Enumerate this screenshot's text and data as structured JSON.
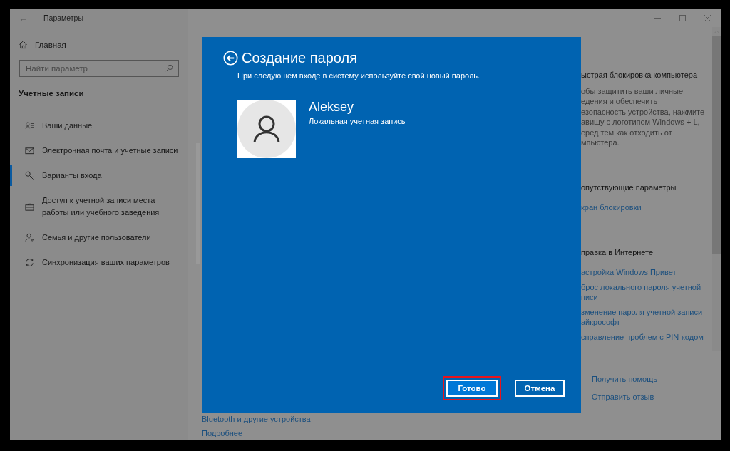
{
  "window": {
    "title": "Параметры",
    "back": "←"
  },
  "sidebar": {
    "home": "Главная",
    "search": {
      "placeholder": "Найти параметр"
    },
    "section": "Учетные записи",
    "items": [
      {
        "label": "Ваши данные",
        "kind": "person-list",
        "selected": false
      },
      {
        "label": "Электронная почта и учетные записи",
        "kind": "mail",
        "selected": false
      },
      {
        "label": "Варианты входа",
        "kind": "key",
        "selected": true
      },
      {
        "label": "Доступ к учетной записи места работы или учебного заведения",
        "kind": "briefcase",
        "selected": false
      },
      {
        "label": "Семья и другие пользователи",
        "kind": "person-add",
        "selected": false
      },
      {
        "label": "Синхронизация ваших параметров",
        "kind": "sync",
        "selected": false
      }
    ]
  },
  "content": {
    "bottom_links": [
      "Bluetooth и другие устройства",
      "Подробнее"
    ],
    "right_panel": [
      {
        "kind": "heading",
        "lines": [
          "ыстрая блокировка компьютера"
        ]
      },
      {
        "kind": "text",
        "lines": [
          "обы защитить ваши личные",
          "едения и обеспечить",
          "езопасность устройства, нажмите",
          "авишу с логотипом Windows + L,",
          "еред тем как отходить от",
          "мпьютера."
        ]
      },
      {
        "kind": "heading",
        "lines": [
          "опутствующие параметры"
        ]
      },
      {
        "kind": "link",
        "lines": [
          "кран блокировки"
        ]
      },
      {
        "kind": "heading",
        "lines": [
          "правка в Интернете"
        ]
      },
      {
        "kind": "link",
        "lines": [
          "астройка Windows Привет"
        ]
      },
      {
        "kind": "link",
        "lines": [
          "брос локального пароля учетной",
          "писи"
        ]
      },
      {
        "kind": "link",
        "lines": [
          "зменение пароля учетной записи",
          "айкрософт"
        ]
      },
      {
        "kind": "link",
        "lines": [
          "справление проблем с PIN-кодом"
        ]
      },
      {
        "kind": "help",
        "lines": [
          "Получить помощь"
        ]
      },
      {
        "kind": "help",
        "lines": [
          "Отправить отзыв"
        ]
      }
    ]
  },
  "dialog": {
    "title": "Создание пароля",
    "subtitle": "При следующем входе в систему используйте свой новый пароль.",
    "user": {
      "name": "Aleksey",
      "account": "Локальная учетная запись"
    },
    "buttons": [
      {
        "label": "Готово",
        "kind": "primary",
        "highlighted": true
      },
      {
        "label": "Отмена",
        "kind": "secondary",
        "highlighted": false
      }
    ]
  }
}
